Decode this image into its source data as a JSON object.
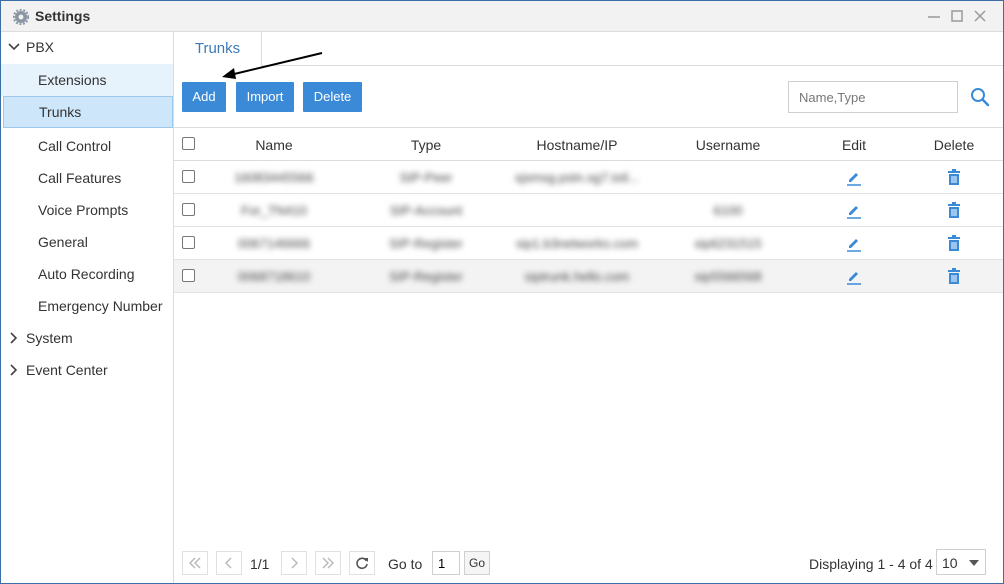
{
  "window": {
    "title": "Settings",
    "icon": "gear-icon",
    "controls": [
      "minimize-icon",
      "maximize-icon",
      "close-icon"
    ]
  },
  "sidebar": {
    "groups": [
      {
        "label": "PBX",
        "expanded": true
      },
      {
        "label": "System",
        "expanded": false
      },
      {
        "label": "Event Center",
        "expanded": false
      }
    ],
    "pbx_items": [
      {
        "label": "Extensions",
        "state": "hover"
      },
      {
        "label": "Trunks",
        "state": "active"
      },
      {
        "label": "Call Control"
      },
      {
        "label": "Call Features"
      },
      {
        "label": "Voice Prompts"
      },
      {
        "label": "General"
      },
      {
        "label": "Auto Recording"
      },
      {
        "label": "Emergency Number"
      }
    ]
  },
  "main": {
    "tab": "Trunks",
    "toolbar": {
      "add_label": "Add",
      "import_label": "Import",
      "delete_label": "Delete",
      "search_placeholder": "Name,Type"
    },
    "table": {
      "headers": [
        "Name",
        "Type",
        "Hostname/IP",
        "Username",
        "Edit",
        "Delete"
      ],
      "rows": [
        {
          "name": "16083445566",
          "type": "SIP-Peer",
          "host": "sjsmsg.pstn.sg7.txtl...",
          "username": ""
        },
        {
          "name": "For_TN410",
          "type": "SIP-Account",
          "host": "",
          "username": "6100"
        },
        {
          "name": "0067146666",
          "type": "SIP-Register",
          "host": "sip1.b3networks.com",
          "username": "sip6231515"
        },
        {
          "name": "0068718610",
          "type": "SIP-Register",
          "host": "siptrunk.hello.com",
          "username": "sip5566568"
        }
      ]
    },
    "pager": {
      "page_indicator": "1/1",
      "goto_label": "Go to",
      "goto_value": "1",
      "go_label": "Go",
      "display_text": "Displaying 1 - 4 of 4",
      "page_size": "10"
    }
  },
  "colors": {
    "accent": "#3a8ad8",
    "tab_text": "#3d7ab6",
    "active_nav": "#cde6f9",
    "window_border": "#3c6ea6"
  }
}
